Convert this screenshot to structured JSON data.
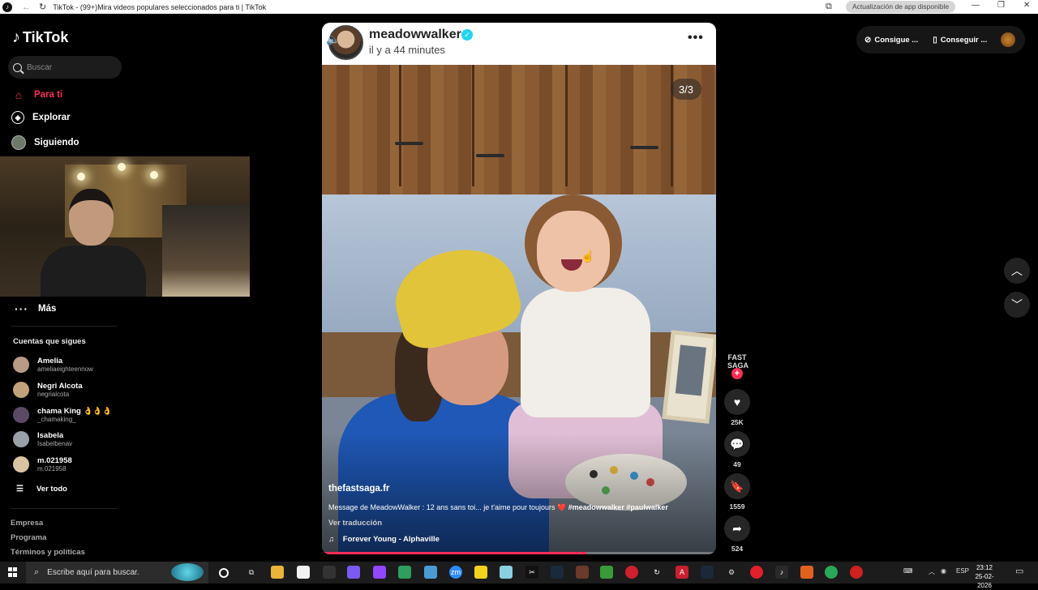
{
  "browser": {
    "title": "TikTok - (99+)Mira videos populares seleccionados para ti | TikTok",
    "update_label": "Actualización de app disponible",
    "icon": "tiktok-icon"
  },
  "sidebar": {
    "logo": "TikTok",
    "search_placeholder": "Buscar",
    "nav": [
      {
        "label": "Para ti",
        "icon": "home-icon",
        "active": true
      },
      {
        "label": "Explorar",
        "icon": "compass-icon"
      },
      {
        "label": "Siguiendo",
        "icon": "following-avatar-icon"
      }
    ],
    "more_label": "Más",
    "following_title": "Cuentas que sigues",
    "accounts": [
      {
        "name": "Amelia",
        "handle": "ameliaeighteennow",
        "color": "#b99a86"
      },
      {
        "name": "Negri Alcota",
        "handle": "negrialcota",
        "color": "#c2a27a"
      },
      {
        "name": "chama King 👌👌👌",
        "handle": "_chamaking_",
        "color": "#5a4a66"
      },
      {
        "name": "Isabela",
        "handle": "Isabelbenav",
        "color": "#9aa0a8"
      },
      {
        "name": "m.021958",
        "handle": "m.021958",
        "color": "#d8c4a0"
      }
    ],
    "see_all": "Ver todo",
    "footer": [
      "Empresa",
      "Programa",
      "Términos y políticas"
    ]
  },
  "post": {
    "username": "meadowwalker",
    "time": "il y a 44 minutes",
    "pager": "3/3",
    "caption_user": "thefastsaga.fr",
    "caption_text": "Message de MeadowWalker : 12 ans sans toi... je t'aime pour toujours",
    "caption_heart": "❤️",
    "caption_tags": "#meadowwalker #paulwalker",
    "translate": "Ver traducción",
    "music": "Forever Young - Alphaville",
    "progress": 0.67
  },
  "rail": {
    "avatar_text": "FAST SAGA",
    "likes": "25K",
    "comments": "49",
    "saves": "1559",
    "shares": "524"
  },
  "topright": {
    "btn1": "Consigue ...",
    "btn2": "Conseguir ..."
  },
  "taskbar": {
    "search": "Escribe aquí para buscar.",
    "lang": "ESP",
    "time": "23:12",
    "date": "25-02-2026"
  },
  "colors": {
    "accent": "#fe2c55",
    "verified": "#20d5ec"
  }
}
